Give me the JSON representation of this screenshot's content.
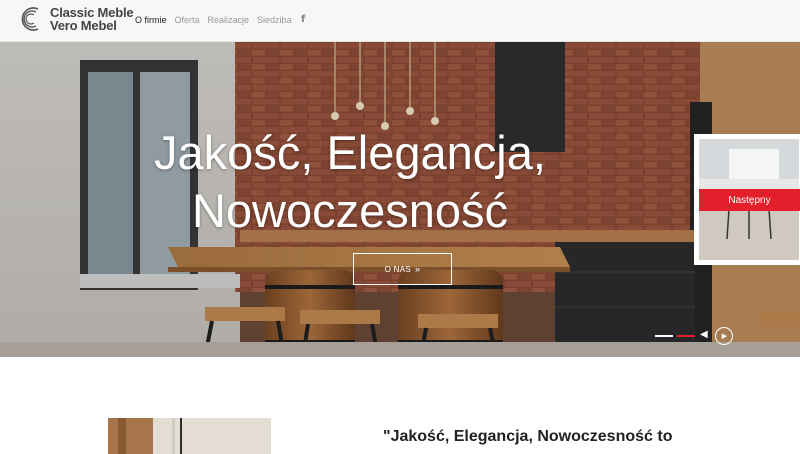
{
  "brand": {
    "line1": "Classic Meble",
    "line2": "Vero Mebel"
  },
  "nav": [
    {
      "label": "O firmie",
      "active": true
    },
    {
      "label": "Oferta",
      "active": false
    },
    {
      "label": "Realizacje",
      "active": false
    },
    {
      "label": "Siedziba",
      "active": false
    }
  ],
  "social": {
    "facebook_icon": "f"
  },
  "hero": {
    "title_line1": "Jakość, Elegancja,",
    "title_line2": "Nowoczesność",
    "button_label": "O NAS",
    "button_icon": "»",
    "next_label": "Następny",
    "prev_icon": "◀",
    "play_icon": "▶"
  },
  "about": {
    "quote": "\"Jakość, Elegancja, Nowoczesność to"
  },
  "colors": {
    "accent": "#e21f2a",
    "header_bg": "#f7f7f7",
    "text_dark": "#222222"
  }
}
